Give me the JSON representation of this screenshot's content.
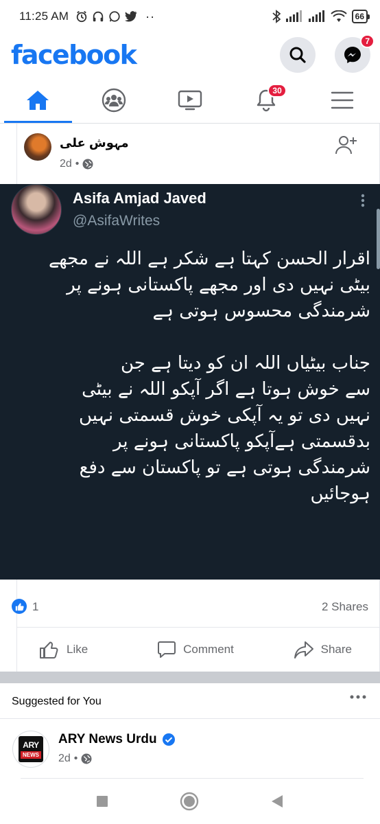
{
  "status_bar": {
    "time": "11:25 AM",
    "battery": "66",
    "icons": [
      "alarm-icon",
      "headphones-icon",
      "whatsapp-icon",
      "twitter-icon",
      "more-dots-icon",
      "bluetooth-icon",
      "signal-icon",
      "signal-icon",
      "wifi-icon",
      "battery-icon"
    ]
  },
  "header": {
    "logo": "facebook",
    "messenger_badge": "7"
  },
  "tabs": [
    {
      "name": "home",
      "active": true
    },
    {
      "name": "groups",
      "active": false
    },
    {
      "name": "watch",
      "active": false
    },
    {
      "name": "notifications",
      "active": false,
      "badge": "30"
    },
    {
      "name": "menu",
      "active": false
    }
  ],
  "post": {
    "author": "مہوش علی",
    "time": "2d",
    "tweet": {
      "name": "Asifa Amjad Javed",
      "handle": "@AsifaWrites",
      "lines_1": [
        "اقرار الحسن کہتا ہے شکر ہے اللہ نے مجھے",
        "بیٹی نہیں دی اور مجھے پاکستانی ہونے پر",
        "شرمندگی محسوس ہوتی ہے"
      ],
      "lines_2": [
        "جناب بیٹیاں اللہ ان کو دیتا ہے جن",
        "سے خوش ہوتا ہے اگر آپکو اللہ نے بیٹی",
        "نہیں دی تو یہ آپکی خوش قسمتی نہیں",
        "بدقسمتی ہےآپکو پاکستانی ہونے پر",
        "شرمندگی ہوتی ہے تو پاکستان سے دفع",
        "ہوجائیں"
      ]
    },
    "like_count": "1",
    "shares": "2 Shares",
    "actions": {
      "like": "Like",
      "comment": "Comment",
      "share": "Share"
    }
  },
  "suggested": {
    "label": "Suggested for You",
    "page_name": "ARY News Urdu",
    "logo_text_top": "ARY",
    "logo_text_bottom": "NEWS",
    "time": "2d"
  },
  "colors": {
    "brand": "#1877f2",
    "tweet_bg": "#15202b",
    "badge": "#e41e3f"
  }
}
